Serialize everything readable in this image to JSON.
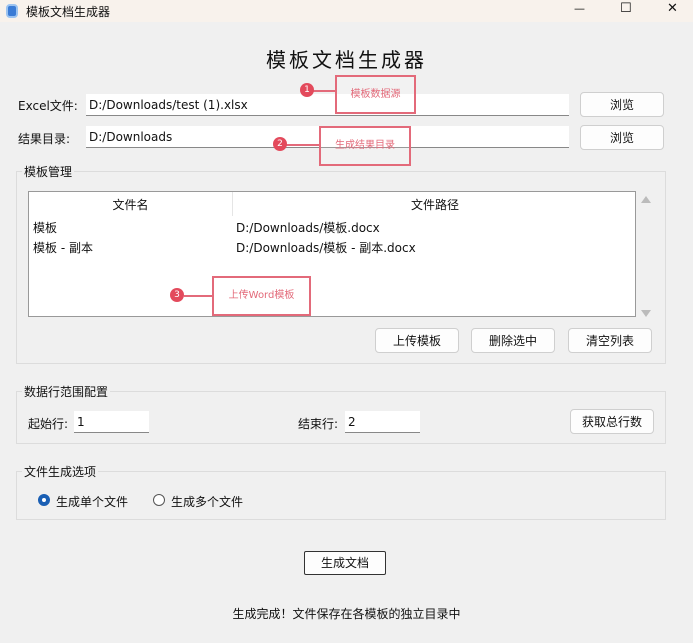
{
  "window": {
    "title": "模板文档生成器",
    "minimize": "—",
    "maximize": "☐",
    "close": "✕"
  },
  "heading": "模板文档生成器",
  "excel": {
    "label": "Excel文件:",
    "value": "D:/Downloads/test (1).xlsx",
    "browse": "浏览"
  },
  "output": {
    "label": "结果目录:",
    "value": "D:/Downloads",
    "browse": "浏览"
  },
  "templates": {
    "title": "模板管理",
    "columns": [
      "文件名",
      "文件路径"
    ],
    "rows": [
      {
        "name": "模板",
        "path": "D:/Downloads/模板.docx"
      },
      {
        "name": "模板 - 副本",
        "path": "D:/Downloads/模板 - 副本.docx"
      }
    ],
    "upload": "上传模板",
    "delete": "删除选中",
    "clear": "清空列表"
  },
  "range": {
    "title": "数据行范围配置",
    "start_label": "起始行:",
    "start": "1",
    "end_label": "结束行:",
    "end": "2",
    "get_total": "获取总行数"
  },
  "options": {
    "title": "文件生成选项",
    "single": "生成单个文件",
    "multiple": "生成多个文件",
    "selected": "single"
  },
  "generate": "生成文档",
  "status": "生成完成！文件保存在各模板的独立目录中",
  "annotations": [
    {
      "n": "1",
      "text": "模板数据源"
    },
    {
      "n": "2",
      "text": "生成结果目录"
    },
    {
      "n": "3",
      "text": "上传Word模板"
    }
  ]
}
